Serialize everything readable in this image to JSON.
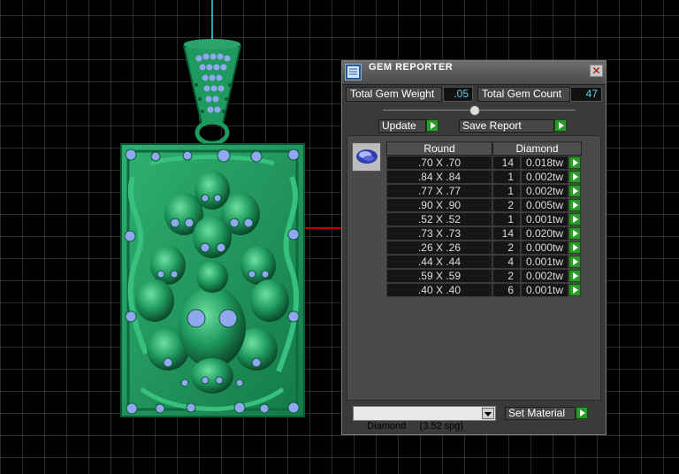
{
  "panel": {
    "title": "GEM REPORTER",
    "close_glyph": "✕",
    "total_weight_label": "Total Gem Weight",
    "total_weight_value": ".05",
    "total_count_label": "Total Gem Count",
    "total_count_value": "47",
    "update_label": "Update",
    "save_report_label": "Save Report",
    "table": {
      "col_shape": "Round",
      "col_material": "Diamond",
      "rows": [
        {
          "size": ".70 X .70",
          "count": "14",
          "weight": "0.018tw"
        },
        {
          "size": ".84 X .84",
          "count": "1",
          "weight": "0.002tw"
        },
        {
          "size": ".77 X .77",
          "count": "1",
          "weight": "0.002tw"
        },
        {
          "size": ".90 X .90",
          "count": "2",
          "weight": "0.005tw"
        },
        {
          "size": ".52 X .52",
          "count": "1",
          "weight": "0.001tw"
        },
        {
          "size": ".73 X .73",
          "count": "14",
          "weight": "0.020tw"
        },
        {
          "size": ".26 X .26",
          "count": "2",
          "weight": "0.000tw"
        },
        {
          "size": ".44 X .44",
          "count": "4",
          "weight": "0.001tw"
        },
        {
          "size": ".59 X .59",
          "count": "2",
          "weight": "0.002tw"
        },
        {
          "size": ".40 X .40",
          "count": "6",
          "weight": "0.001tw"
        }
      ]
    },
    "material_select": "Diamond     (3.52 spg)",
    "set_material_label": "Set Material"
  },
  "colors": {
    "model_green": "#1f8f5a",
    "gem_blue": "#8fa8f0",
    "grid": "#5a5a5a",
    "axis_red": "#c00000",
    "axis_cyan": "#2aa8b8",
    "value_text": "#5bd0f0",
    "arrow_green": "#2b9a2b"
  },
  "icons": {
    "title": "gem-reporter-icon",
    "close": "close-icon",
    "gem_preview": "round-diamond-icon",
    "arrow": "green-arrow-icon",
    "dropdown": "chevron-down-icon"
  }
}
